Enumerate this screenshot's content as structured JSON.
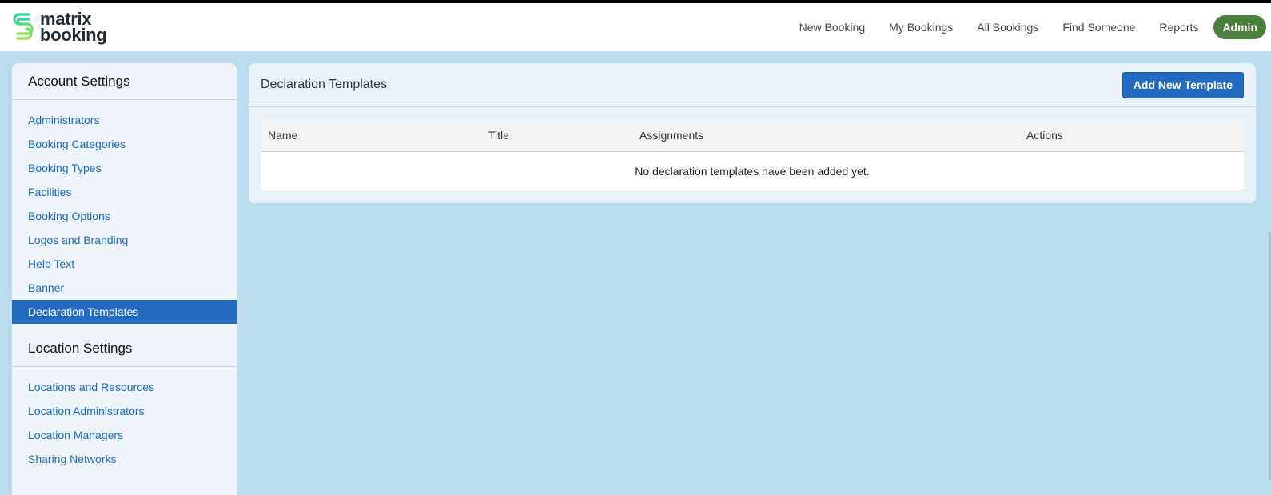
{
  "logo": {
    "line1": "matrix",
    "line2": "booking"
  },
  "nav": {
    "items": [
      "New Booking",
      "My Bookings",
      "All Bookings",
      "Find Someone",
      "Reports"
    ],
    "admin": "Admin"
  },
  "sidebar": {
    "account_title": "Account Settings",
    "account_items": [
      "Administrators",
      "Booking Categories",
      "Booking Types",
      "Facilities",
      "Booking Options",
      "Logos and Branding",
      "Help Text",
      "Banner",
      "Declaration Templates"
    ],
    "active_item": "Declaration Templates",
    "location_title": "Location Settings",
    "location_items": [
      "Locations and Resources",
      "Location Administrators",
      "Location Managers",
      "Sharing Networks"
    ]
  },
  "panel": {
    "title": "Declaration Templates",
    "add_button": "Add New Template",
    "columns": [
      "Name",
      "Title",
      "Assignments",
      "Actions"
    ],
    "empty_message": "No declaration templates have been added yet."
  },
  "colors": {
    "accent": "#236ac0",
    "admin_pill": "#4b7f3c",
    "page_bg": "#bcdcee",
    "link": "#1d6bbf"
  }
}
